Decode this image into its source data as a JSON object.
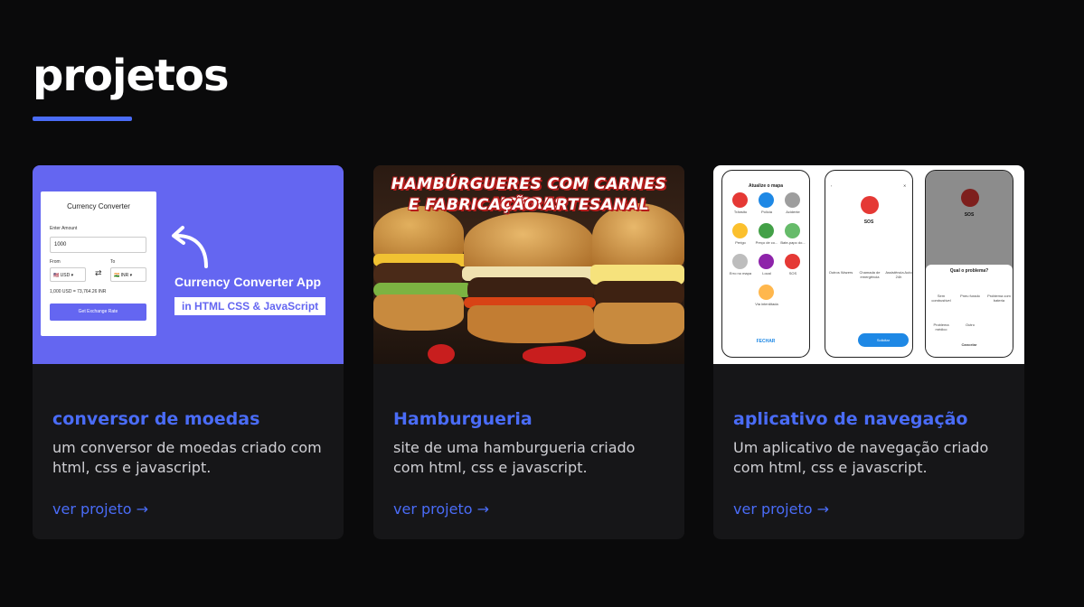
{
  "section": {
    "title": "projetos"
  },
  "projects": [
    {
      "title": "conversor de moedas",
      "description": "um conversor de moedas criado com html, css e javascript.",
      "link": "ver projeto →",
      "thumb": {
        "panel_title": "Currency Converter",
        "amount_label": "Enter Amount",
        "amount_value": "1000",
        "from_label": "From",
        "to_label": "To",
        "from_currency": "USD",
        "to_currency": "INR",
        "result": "1,000 USD = 73,764.26 INR",
        "button": "Get Exchange Rate",
        "heading": "Currency Converter App",
        "subheading": "in HTML CSS & JavaScript"
      }
    },
    {
      "title": "Hamburgueria",
      "description": "site de uma hamburgueria criado com html, css e javascript.",
      "link": "ver projeto →",
      "thumb": {
        "line1": "HAMBÚRGUERES COM CARNES NOBRES",
        "line2": "E FABRICAÇÃO ARTESANAL"
      }
    },
    {
      "title": "aplicativo de navegação",
      "description": "Um aplicativo de navegação criado com html, css e javascript.",
      "link": "ver projeto →",
      "thumb": {
        "screen1_title": "Atualize o mapa",
        "screen1_items": [
          "Trânsito",
          "Polícia",
          "Acidente",
          "Perigo",
          "Preço de co...",
          "Bate-papo do...",
          "Erro no mapa",
          "Local",
          "SOS",
          "Via interditada"
        ],
        "screen1_close": "FECHAR",
        "screen2_title": "SOS",
        "screen2_items": [
          "Outros Wazers",
          "Chamada de emergência",
          "Assistência Auto 24h"
        ],
        "screen2_button": "Solicitar",
        "screen3_title": "SOS",
        "screen3_sheet_title": "Qual o problema?",
        "screen3_items": [
          "Sem combustível",
          "Pneu furado",
          "Problema com bateria",
          "Problema médico",
          "Outro"
        ],
        "screen3_cancel": "Cancelar"
      }
    }
  ],
  "colors": {
    "accent": "#4a6cf7",
    "background": "#0a0a0b",
    "card": "#161618",
    "converter_purple": "#6466f1"
  }
}
